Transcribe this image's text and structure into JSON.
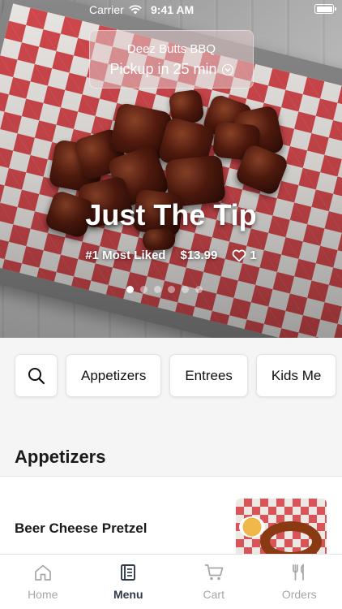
{
  "status_bar": {
    "carrier": "Carrier",
    "time": "9:41 AM"
  },
  "header": {
    "restaurant_name": "Deez Butts BBQ",
    "pickup_text": "Pickup in 25 min"
  },
  "hero": {
    "title": "Just The Tip",
    "rank": "#1 Most Liked",
    "price": "$13.99",
    "likes": "1",
    "carousel_pages": 6,
    "carousel_active": 1
  },
  "categories": [
    "Appetizers",
    "Entrees",
    "Kids Me"
  ],
  "sections": [
    {
      "title": "Appetizers",
      "items": [
        {
          "name": "Beer Cheese Pretzel"
        }
      ]
    }
  ],
  "tab_bar": {
    "tabs": [
      {
        "label": "Home",
        "icon": "house-icon"
      },
      {
        "label": "Menu",
        "icon": "menu-book-icon"
      },
      {
        "label": "Cart",
        "icon": "cart-icon"
      },
      {
        "label": "Orders",
        "icon": "fork-knife-icon"
      }
    ],
    "active": "Menu"
  },
  "colors": {
    "accent": "#2f3b4a",
    "inactive": "#a6a6a6",
    "checker_red": "#d62e34"
  }
}
